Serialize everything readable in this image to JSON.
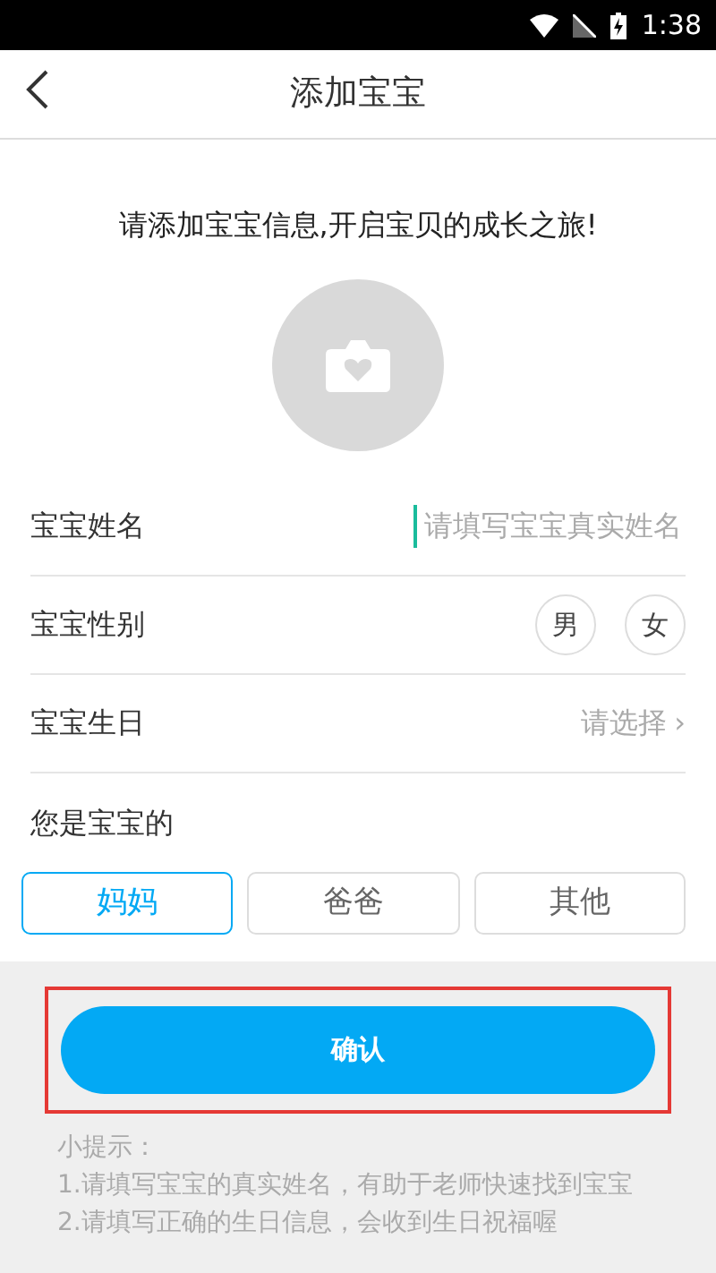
{
  "status_bar": {
    "time": "1:38"
  },
  "header": {
    "title": "添加宝宝"
  },
  "intro": "请添加宝宝信息,开启宝贝的成长之旅!",
  "form": {
    "name": {
      "label": "宝宝姓名",
      "placeholder": "请填写宝宝真实姓名"
    },
    "gender": {
      "label": "宝宝性别",
      "options": [
        {
          "label": "男",
          "selected": false
        },
        {
          "label": "女",
          "selected": false
        }
      ]
    },
    "birthday": {
      "label": "宝宝生日",
      "value": "请选择",
      "chevron": "›"
    },
    "relation": {
      "label": "您是宝宝的",
      "options": [
        {
          "label": "妈妈",
          "selected": true
        },
        {
          "label": "爸爸",
          "selected": false
        },
        {
          "label": "其他",
          "selected": false
        }
      ]
    }
  },
  "confirm_button": "确认",
  "tips": [
    "小提示：",
    "1.请填写宝宝的真实姓名，有助于老师快速找到宝宝",
    "2.请填写正确的生日信息，会收到生日祝福喔"
  ]
}
